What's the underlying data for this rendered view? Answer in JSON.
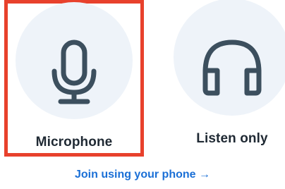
{
  "options": [
    {
      "label": "Microphone",
      "icon": "microphone-icon",
      "selected": true
    },
    {
      "label": "Listen only",
      "icon": "headphones-icon",
      "selected": false
    }
  ],
  "join_link": {
    "label": "Join using your phone",
    "arrow": "→"
  },
  "colors": {
    "selection_border": "#e8412c",
    "icon_circle": "#eef3f9",
    "icon_stroke": "#3c4f5e",
    "label_text": "#1f2933",
    "link": "#1a6fd6"
  }
}
